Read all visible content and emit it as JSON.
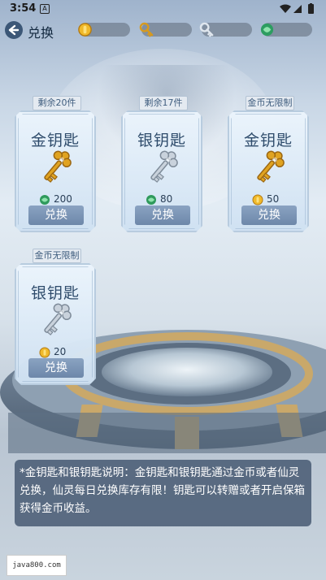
{
  "status_bar": {
    "time": "3:54",
    "notification_icon": "A"
  },
  "header": {
    "title": "兑换",
    "back_icon": "back-arrow-icon"
  },
  "currencies": [
    {
      "icon": "gold-coin-icon",
      "value": ""
    },
    {
      "icon": "gold-key-icon",
      "value": ""
    },
    {
      "icon": "silver-key-icon",
      "value": ""
    },
    {
      "icon": "fairy-spirit-icon",
      "value": ""
    }
  ],
  "cards": [
    {
      "tag": "剩余20件",
      "name": "金钥匙",
      "key": "gold",
      "price_icon": "spirit",
      "price": "200",
      "button": "兑换"
    },
    {
      "tag": "剩余17件",
      "name": "银钥匙",
      "key": "silver",
      "price_icon": "spirit",
      "price": "80",
      "button": "兑换"
    },
    {
      "tag": "金币无限制",
      "name": "金钥匙",
      "key": "gold",
      "price_icon": "coin",
      "price": "50",
      "button": "兑换"
    },
    {
      "tag": "金币无限制",
      "name": "银钥匙",
      "key": "silver",
      "price_icon": "coin",
      "price": "20",
      "button": "兑换"
    }
  ],
  "description": "*金钥匙和银钥匙说明：金钥匙和银钥匙通过金币或者仙灵兑换，仙灵每日兑换库存有限！钥匙可以转赠或者开启保箱获得金币收益。",
  "watermark": "java800.com",
  "colors": {
    "gold": "#e0a321",
    "silver": "#c9d2dc",
    "spirit": "#2f9a5c",
    "button": "#7891b3"
  }
}
